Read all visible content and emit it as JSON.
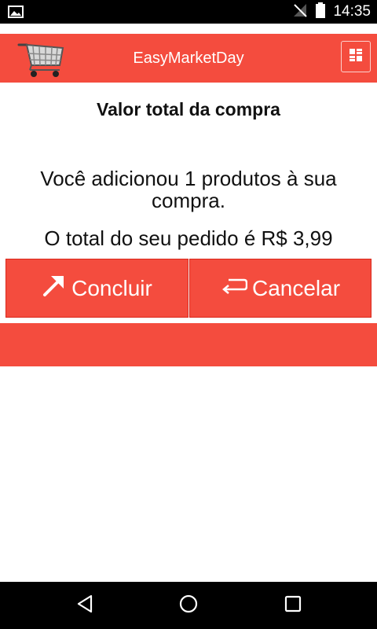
{
  "status_bar": {
    "time": "14:35",
    "icons": [
      "image-notification-icon",
      "no-signal-icon",
      "battery-icon"
    ]
  },
  "app_bar": {
    "title": "EasyMarketDay",
    "logo_icon": "shopping-cart-icon",
    "menu_icon": "grid-menu-icon"
  },
  "content": {
    "heading": "Valor total da compra",
    "info": "Você adicionou 1 produtos à sua compra.",
    "total": "O total do seu pedido é R$ 3,99"
  },
  "buttons": {
    "concluir": {
      "label": "Concluir",
      "icon": "arrow-up-right-icon"
    },
    "cancelar": {
      "label": "Cancelar",
      "icon": "return-arrow-icon"
    }
  },
  "nav_bar": {
    "back_icon": "back-triangle-icon",
    "home_icon": "home-circle-icon",
    "recent_icon": "recent-apps-square-icon"
  },
  "colors": {
    "accent": "#f44c3e",
    "status_bar": "#000000",
    "text": "#111111"
  }
}
